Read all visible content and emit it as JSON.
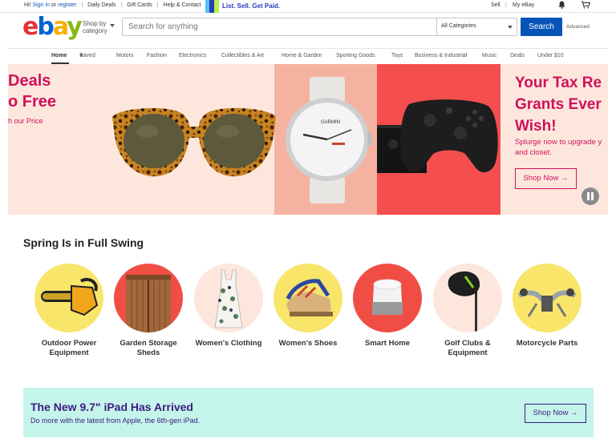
{
  "topbar": {
    "greeting": "Hi!",
    "signin": "Sign in",
    "or": "or",
    "register": "register",
    "daily_deals": "Daily Deals",
    "gift_cards": "Gift Cards",
    "help": "Help & Contact",
    "promo": "List. Sell. Get Paid.",
    "sell": "Sell",
    "sep": "|",
    "my_ebay": "My eBay"
  },
  "header": {
    "logo": {
      "e": "e",
      "b": "b",
      "a": "a",
      "y": "y"
    },
    "shop_by_line1": "Shop by",
    "shop_by_line2": "category",
    "search_placeholder": "Search for anything",
    "category_select": "All Categories",
    "search_button": "Search",
    "advanced": "Advanced"
  },
  "nav": {
    "items": [
      "Home",
      "Saved",
      "Motors",
      "Fashion",
      "Electronics",
      "Collectibles & Art",
      "Home & Garden",
      "Sporting Goods",
      "Toys",
      "Business & Industrial",
      "Music",
      "Deals",
      "Under $10"
    ]
  },
  "hero": {
    "left_line1": "Deals",
    "left_line2": "o Free",
    "left_line3": "h our Price",
    "right_line1": "Your Tax Re",
    "right_line2": "Grants Ever",
    "right_line3": "Wish!",
    "right_sub1": "Splurge now to upgrade y",
    "right_sub2": "and closet.",
    "button": "Shop Now →",
    "watch_brand": "GARMIN",
    "colors": {
      "accent": "#d0105b",
      "panel_pink": "#fde7dd",
      "panel_salmon": "#f6b2a0",
      "panel_red": "#f44e4e"
    }
  },
  "spring": {
    "title": "Spring Is in Full Swing",
    "categories": [
      {
        "label": "Outdoor Power Equipment",
        "icon": "chainsaw-icon",
        "bg": "#f8e56a"
      },
      {
        "label": "Garden Storage Sheds",
        "icon": "shed-icon",
        "bg": "#f04e45"
      },
      {
        "label": "Women's Clothing",
        "icon": "dress-icon",
        "bg": "#fde7dd"
      },
      {
        "label": "Women's Shoes",
        "icon": "wedge-shoe-icon",
        "bg": "#f8e56a"
      },
      {
        "label": "Smart Home",
        "icon": "smart-speaker-icon",
        "bg": "#f04e45"
      },
      {
        "label": "Golf Clubs & Equipment",
        "icon": "golf-club-icon",
        "bg": "#fde7dd"
      },
      {
        "label": "Motorcycle Parts",
        "icon": "handlebar-icon",
        "bg": "#f8e56a"
      }
    ]
  },
  "banner": {
    "title": "The New 9.7\" iPad Has Arrived",
    "subtitle": "Do more with the latest from Apple, the 6th-gen iPad.",
    "button": "Shop Now →",
    "bg": "#c5f4ea",
    "accent": "#3a1c80"
  }
}
